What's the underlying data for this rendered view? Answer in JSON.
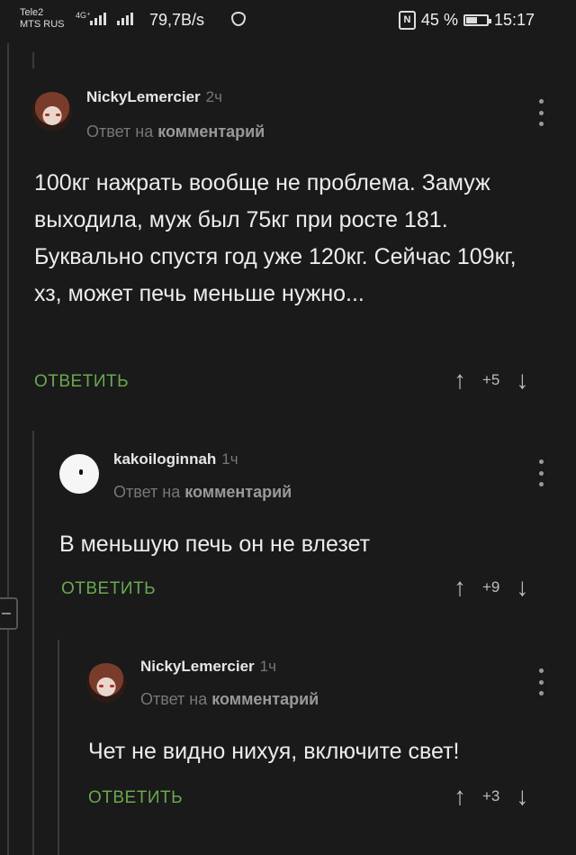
{
  "status_bar": {
    "carrier_1": "Tele2",
    "carrier_2": "MTS RUS",
    "network_tag": "4G⁺",
    "net_speed": "79,7B/s",
    "nfc_label": "N",
    "battery": "45 %",
    "time": "15:17"
  },
  "comments": [
    {
      "author": "NickyLemercier",
      "time": "2ч",
      "reply_prefix": "Ответ на",
      "reply_link": "комментарий",
      "text": "100кг нажрать вообще не проблема. Замуж выходила, муж был 75кг при росте 181. Буквально спустя год уже 120кг. Сейчас 109кг, хз, может печь меньше нужно...",
      "reply_label": "ОТВЕТИТЬ",
      "score": "+5",
      "avatar_icon": "anime-girl-avatar"
    },
    {
      "author": "kakoiloginnah",
      "time": "1ч",
      "reply_prefix": "Ответ на",
      "reply_link": "комментарий",
      "text": "В меньшую печь он не влезет",
      "reply_label": "ОТВЕТИТЬ",
      "score": "+9",
      "avatar_icon": "white-circle-avatar"
    },
    {
      "author": "NickyLemercier",
      "time": "1ч",
      "reply_prefix": "Ответ на",
      "reply_link": "комментарий",
      "text": "Чет не видно нихуя, включите свет!",
      "reply_label": "ОТВЕТИТЬ",
      "score": "+3",
      "avatar_icon": "anime-girl-avatar"
    }
  ],
  "icons": {
    "upvote": "↑",
    "downvote": "↓"
  },
  "colors": {
    "background": "#1a1a1a",
    "reply_green": "#6aa84f",
    "muted_text": "#777777"
  }
}
